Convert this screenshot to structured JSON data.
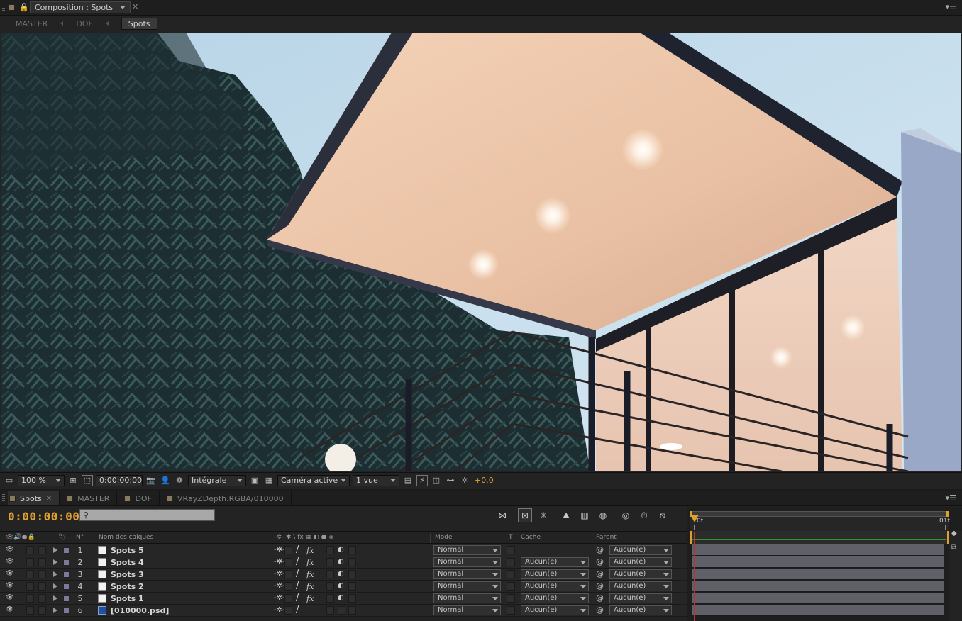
{
  "comp_panel": {
    "tab_label": "Composition : Spots",
    "breadcrumbs": [
      "MASTER",
      "DOF",
      "Spots"
    ]
  },
  "viewer_toolbar": {
    "zoom": "100 %",
    "timecode": "0:00:00:00",
    "resolution": "Intégrale",
    "camera": "Caméra active",
    "views": "1 vue",
    "exposure": "+0.0"
  },
  "timeline": {
    "tabs": [
      "Spots",
      "MASTER",
      "DOF",
      "VRayZDepth.RGBA/010000"
    ],
    "current_time": "0:00:00:00",
    "search": {
      "value": "",
      "placeholder": ""
    },
    "columns": {
      "num": "N°",
      "layer_name": "Nom des calques",
      "mode": "Mode",
      "t": "T",
      "cache": "Cache",
      "parent": "Parent"
    },
    "ruler_ticks": [
      "0f",
      "01f"
    ],
    "layers": [
      {
        "num": "1",
        "name": "Spots 5",
        "mode": "Normal",
        "cache": "",
        "parent": "Aucun(e)",
        "fx": true,
        "type": "solid"
      },
      {
        "num": "2",
        "name": "Spots 4",
        "mode": "Normal",
        "cache": "Aucun(e)",
        "parent": "Aucun(e)",
        "fx": true,
        "type": "solid"
      },
      {
        "num": "3",
        "name": "Spots 3",
        "mode": "Normal",
        "cache": "Aucun(e)",
        "parent": "Aucun(e)",
        "fx": true,
        "type": "solid"
      },
      {
        "num": "4",
        "name": "Spots 2",
        "mode": "Normal",
        "cache": "Aucun(e)",
        "parent": "Aucun(e)",
        "fx": true,
        "type": "solid"
      },
      {
        "num": "5",
        "name": "Spots 1",
        "mode": "Normal",
        "cache": "Aucun(e)",
        "parent": "Aucun(e)",
        "fx": true,
        "type": "solid"
      },
      {
        "num": "6",
        "name": "[010000.psd]",
        "mode": "Normal",
        "cache": "Aucun(e)",
        "parent": "Aucun(e)",
        "fx": false,
        "type": "psd"
      }
    ]
  },
  "colors": {
    "timecode": "#e0a030",
    "playhead": "#e0a030",
    "work_area": "#2a9b2a",
    "label_lavender": "#7b7b99",
    "track": "#606069"
  }
}
